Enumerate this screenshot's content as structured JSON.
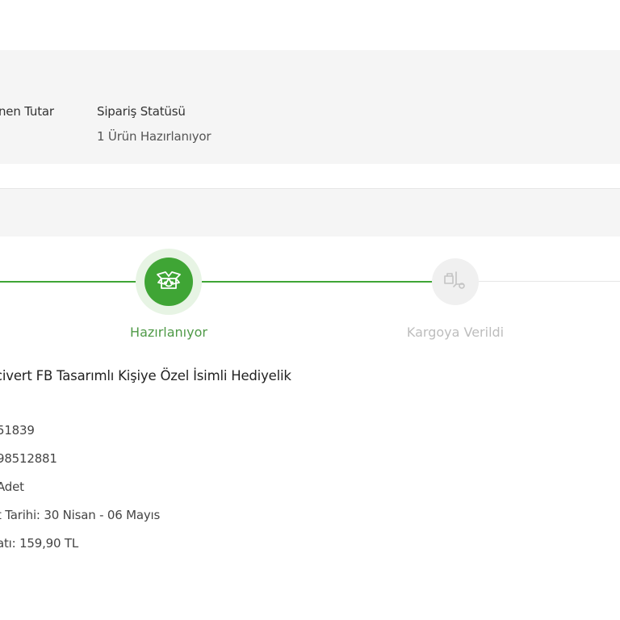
{
  "order_summary": {
    "amount_label_partial": "nen Tutar",
    "status_label": "Sipariş Statüsü",
    "status_value": "1 Ürün Hazırlanıyor"
  },
  "tracker": {
    "active_color": "#3fa535",
    "inactive_color": "#b5b5b5",
    "steps": [
      {
        "label": "Hazırlanıyor",
        "state": "active",
        "icon": "open-box-icon"
      },
      {
        "label": "Kargoya Verildi",
        "state": "inactive",
        "icon": "delivery-truck-icon"
      }
    ]
  },
  "product": {
    "title": "civert FB Tasarımlı Kişiye Özel İsimli Hediyelik",
    "details": [
      "51839",
      "98512881",
      "Adet",
      "t Tarihi: 30 Nisan - 06 Mayıs",
      "atı: 159,90 TL"
    ]
  }
}
